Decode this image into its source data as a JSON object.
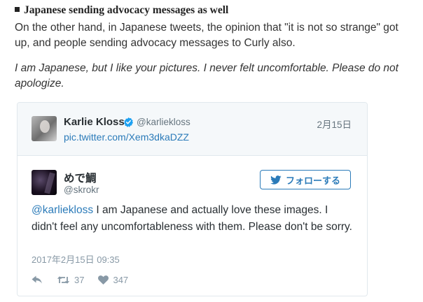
{
  "article": {
    "heading": "Japanese sending advocacy messages as well",
    "paragraph": "On the other hand, in Japanese tweets, the opinion that \"it is not so strange\" got up, and people sending advocacy messages to Curly also.",
    "quote": "I am Japanese, but I like your pictures. I never felt uncomfortable. Please do not apologize."
  },
  "quoted_tweet": {
    "name": "Karlie Kloss",
    "handle": "@karliekloss",
    "date": "2月15日",
    "link": "pic.twitter.com/Xem3dkaDZZ"
  },
  "tweet": {
    "name": "めで鯛",
    "handle": "@skrokr",
    "follow_label": "フォローする",
    "mention": "@karliekloss",
    "text": " I am Japanese and actually love these images. I didn't feel any uncomfortableness with them. Please don't be sorry.",
    "timestamp": "2017年2月15日 09:35",
    "retweets": "37",
    "likes": "347"
  },
  "colors": {
    "link": "#2b7bb9",
    "muted": "#8899a6",
    "verified": "#1da1f2"
  },
  "icons": [
    "verified-badge-icon",
    "twitter-bird-icon",
    "reply-icon",
    "retweet-icon",
    "heart-icon"
  ]
}
